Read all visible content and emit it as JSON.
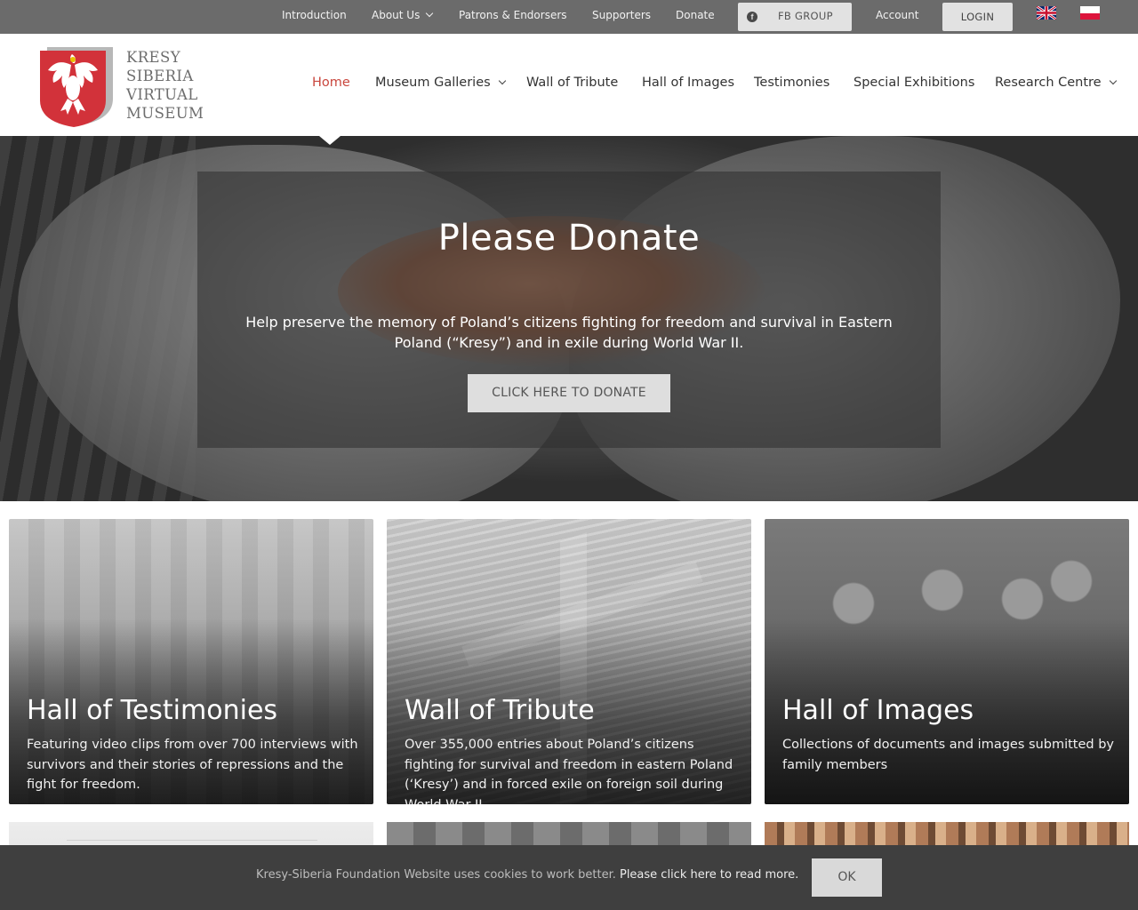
{
  "topbar": {
    "links": [
      {
        "label": "Introduction"
      },
      {
        "label": "About Us"
      },
      {
        "label": "Patrons & Endorsers"
      },
      {
        "label": "Supporters"
      },
      {
        "label": "Donate"
      }
    ],
    "fb_group_label": "FB GROUP",
    "account_label": "Account",
    "login_label": "LOGIN",
    "languages": [
      "english-flag-icon",
      "polish-flag-icon"
    ]
  },
  "logo": {
    "lines": [
      "KRESY",
      "SIBERIA",
      "VIRTUAL",
      "MUSEUM"
    ],
    "emblem": "polish-eagle-shield-icon"
  },
  "nav": {
    "items": [
      {
        "label": "Home",
        "active": true
      },
      {
        "label": "Museum Galleries",
        "dropdown": true
      },
      {
        "label": "Wall of Tribute"
      },
      {
        "label": "Hall of Images"
      },
      {
        "label": "Testimonies"
      },
      {
        "label": "Special Exhibitions"
      },
      {
        "label": "Research Centre",
        "dropdown": true
      }
    ]
  },
  "hero": {
    "title": "Please Donate",
    "description": "Help preserve the memory of Poland’s citizens fighting for freedom and survival in Eastern Poland (“Kresy”) and in exile during World War II.",
    "button_label": "CLICK HERE TO DONATE"
  },
  "cards": [
    {
      "title": "Hall of Testimonies",
      "description": "Featuring video clips from over 700 interviews with survivors and their stories of repressions and the fight for freedom."
    },
    {
      "title": "Wall of Tribute",
      "description": "Over 355,000 entries about Poland’s citizens fighting for survival and freedom in eastern Poland (‘Kresy’) and in forced exile on foreign soil during World War II."
    },
    {
      "title": "Hall of Images",
      "description": "Collections of documents and images submitted by family members"
    }
  ],
  "cookie": {
    "text": "Kresy-Siberia Foundation Website uses cookies to work better. ",
    "link": "Please click here to read more.",
    "ok_label": "OK"
  },
  "colors": {
    "topbar_bg": "#6b6b6b",
    "nav_active": "#c9463d",
    "cookie_bg": "#3f3f3f",
    "flag_red": "#dc143c"
  }
}
